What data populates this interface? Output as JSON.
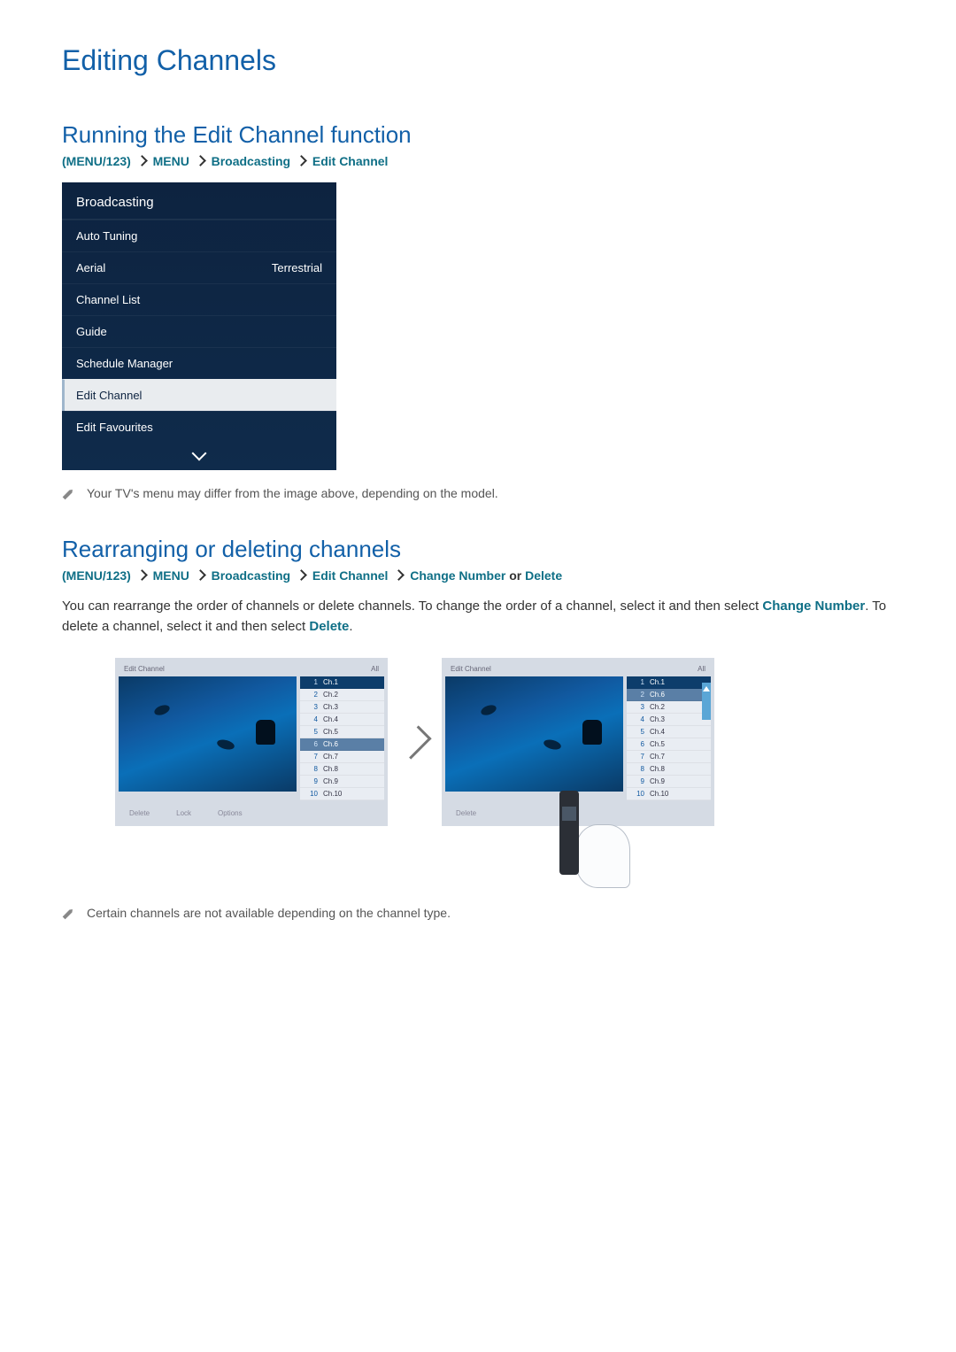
{
  "page": {
    "title": "Editing Channels"
  },
  "section1": {
    "title": "Running the Edit Channel function",
    "breadcrumb": {
      "prefix": "(",
      "menu123": "MENU/123",
      "suffix": ")",
      "parts": [
        "MENU",
        "Broadcasting",
        "Edit Channel"
      ]
    },
    "menu": {
      "header": "Broadcasting",
      "items": [
        {
          "label": "Auto Tuning",
          "value": ""
        },
        {
          "label": "Aerial",
          "value": "Terrestrial"
        },
        {
          "label": "Channel List",
          "value": ""
        },
        {
          "label": "Guide",
          "value": ""
        },
        {
          "label": "Schedule Manager",
          "value": ""
        },
        {
          "label": "Edit Channel",
          "value": "",
          "highlight": true
        },
        {
          "label": "Edit Favourites",
          "value": ""
        }
      ]
    },
    "note": "Your TV's menu may differ from the image above, depending on the model."
  },
  "section2": {
    "title": "Rearranging or deleting channels",
    "breadcrumb": {
      "prefix": "(",
      "menu123": "MENU/123",
      "suffix": ")",
      "parts": [
        "MENU",
        "Broadcasting",
        "Edit Channel",
        "Change Number"
      ],
      "tail_plain": " or ",
      "tail_teal": "Delete"
    },
    "paragraph": {
      "t1": "You can rearrange the order of channels or delete channels. To change the order of a channel, select it and then select ",
      "k1": "Change Number",
      "t2": ". To delete a channel, select it and then select ",
      "k2": "Delete",
      "t3": "."
    },
    "shot": {
      "title": "Edit Channel",
      "filter": "All",
      "btn_delete": "Delete",
      "btn_lock": "Lock",
      "btn_options": "Options",
      "channels": [
        {
          "n": "1",
          "name": "Ch.1"
        },
        {
          "n": "2",
          "name": "Ch.2"
        },
        {
          "n": "3",
          "name": "Ch.3"
        },
        {
          "n": "4",
          "name": "Ch.4"
        },
        {
          "n": "5",
          "name": "Ch.5"
        },
        {
          "n": "6",
          "name": "Ch.6"
        },
        {
          "n": "7",
          "name": "Ch.7"
        },
        {
          "n": "8",
          "name": "Ch.8"
        },
        {
          "n": "9",
          "name": "Ch.9"
        },
        {
          "n": "10",
          "name": "Ch.10"
        }
      ],
      "channels_after": [
        {
          "n": "1",
          "name": "Ch.1"
        },
        {
          "n": "2",
          "name": "Ch.6"
        },
        {
          "n": "3",
          "name": "Ch.2"
        },
        {
          "n": "4",
          "name": "Ch.3"
        },
        {
          "n": "5",
          "name": "Ch.4"
        },
        {
          "n": "6",
          "name": "Ch.5"
        },
        {
          "n": "7",
          "name": "Ch.7"
        },
        {
          "n": "8",
          "name": "Ch.8"
        },
        {
          "n": "9",
          "name": "Ch.9"
        },
        {
          "n": "10",
          "name": "Ch.10"
        }
      ]
    },
    "note": "Certain channels are not available depending on the channel type."
  }
}
